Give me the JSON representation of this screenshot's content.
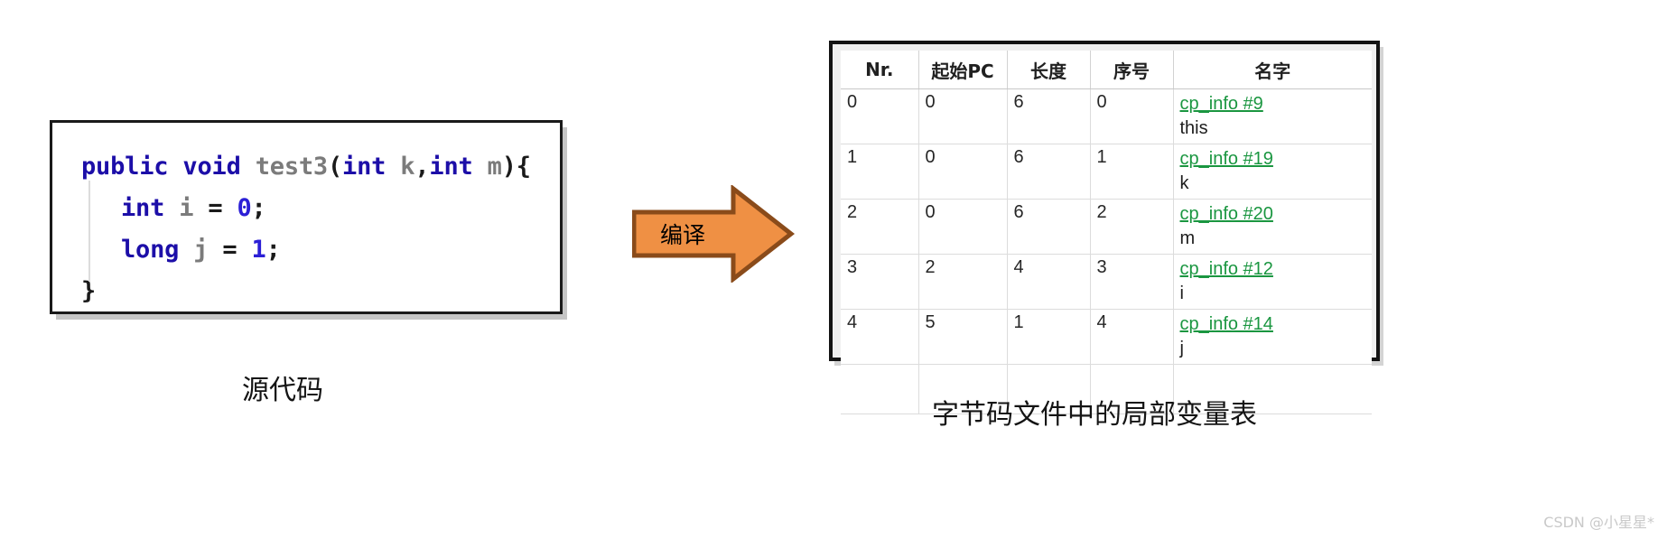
{
  "source_panel": {
    "label": "源代码",
    "code_lines": [
      {
        "indent": false,
        "tokens": [
          {
            "t": "public",
            "c": "kw"
          },
          {
            "t": " ",
            "c": "pn"
          },
          {
            "t": "void",
            "c": "kw"
          },
          {
            "t": " ",
            "c": "pn"
          },
          {
            "t": "test3",
            "c": "id"
          },
          {
            "t": "(",
            "c": "pn"
          },
          {
            "t": "int",
            "c": "kw"
          },
          {
            "t": " ",
            "c": "pn"
          },
          {
            "t": "k",
            "c": "id"
          },
          {
            "t": ",",
            "c": "pn"
          },
          {
            "t": "int",
            "c": "kw"
          },
          {
            "t": " ",
            "c": "pn"
          },
          {
            "t": "m",
            "c": "id"
          },
          {
            "t": ")",
            "c": "pn"
          },
          {
            "t": "{",
            "c": "brace"
          }
        ]
      },
      {
        "indent": true,
        "tokens": [
          {
            "t": "int",
            "c": "kw"
          },
          {
            "t": " ",
            "c": "pn"
          },
          {
            "t": "i",
            "c": "id"
          },
          {
            "t": " ",
            "c": "pn"
          },
          {
            "t": "=",
            "c": "pn"
          },
          {
            "t": " ",
            "c": "pn"
          },
          {
            "t": "0",
            "c": "num"
          },
          {
            "t": ";",
            "c": "pn"
          }
        ]
      },
      {
        "indent": true,
        "tokens": [
          {
            "t": "long",
            "c": "kw"
          },
          {
            "t": " ",
            "c": "pn"
          },
          {
            "t": "j",
            "c": "id"
          },
          {
            "t": " ",
            "c": "pn"
          },
          {
            "t": "=",
            "c": "pn"
          },
          {
            "t": " ",
            "c": "pn"
          },
          {
            "t": "1",
            "c": "num"
          },
          {
            "t": ";",
            "c": "pn"
          }
        ]
      },
      {
        "indent": false,
        "tokens": [
          {
            "t": "}",
            "c": "brace"
          }
        ]
      }
    ]
  },
  "arrow": {
    "label": "编译",
    "fill_color": "#EF9044",
    "stroke_color": "#8A4B1A"
  },
  "table_panel": {
    "caption": "字节码文件中的局部变量表",
    "link_color": "#1A9640",
    "headers": [
      "Nr.",
      "起始PC",
      "长度",
      "序号",
      "名字"
    ],
    "rows": [
      {
        "nr": "0",
        "start_pc": "0",
        "length": "6",
        "index": "0",
        "name_link": "cp_info #9",
        "name_value": "this"
      },
      {
        "nr": "1",
        "start_pc": "0",
        "length": "6",
        "index": "1",
        "name_link": "cp_info #19",
        "name_value": "k"
      },
      {
        "nr": "2",
        "start_pc": "0",
        "length": "6",
        "index": "2",
        "name_link": "cp_info #20",
        "name_value": "m"
      },
      {
        "nr": "3",
        "start_pc": "2",
        "length": "4",
        "index": "3",
        "name_link": "cp_info #12",
        "name_value": "i"
      },
      {
        "nr": "4",
        "start_pc": "5",
        "length": "1",
        "index": "4",
        "name_link": "cp_info #14",
        "name_value": "j"
      }
    ]
  },
  "watermark": "CSDN @小星星*"
}
